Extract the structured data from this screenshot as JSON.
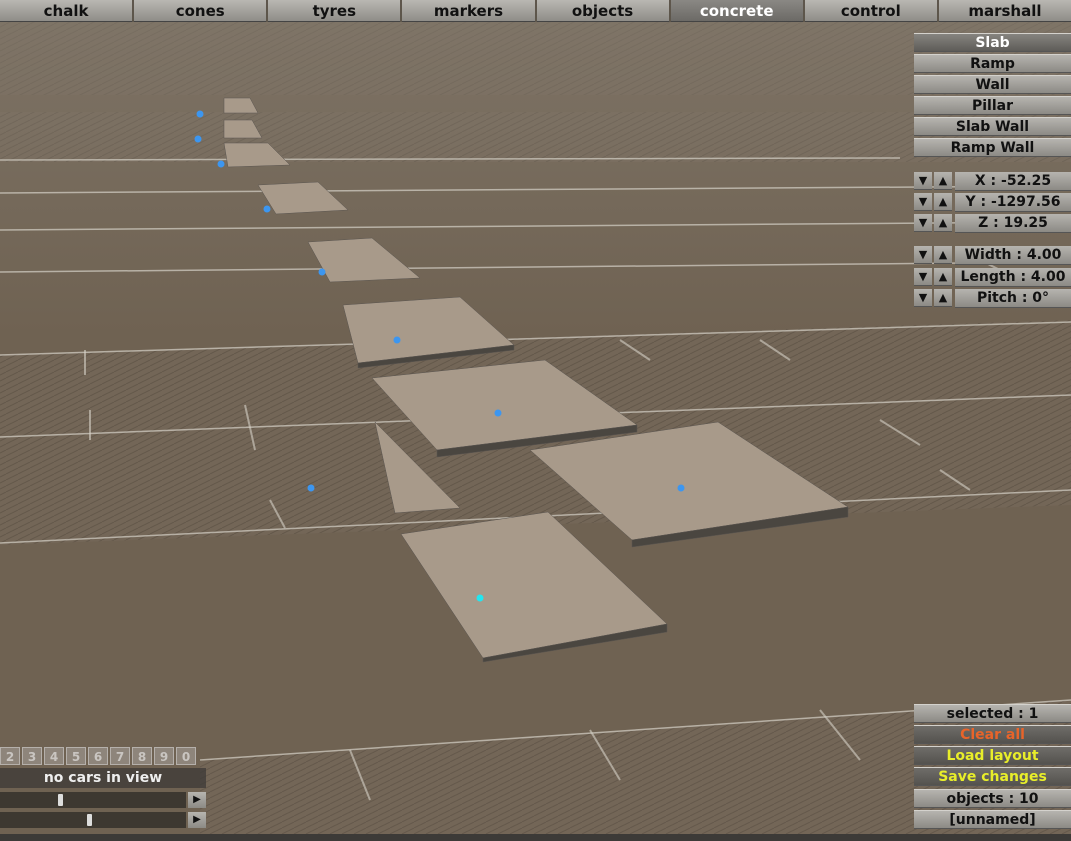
{
  "tabs": [
    {
      "label": "chalk"
    },
    {
      "label": "cones"
    },
    {
      "label": "tyres"
    },
    {
      "label": "markers"
    },
    {
      "label": "objects"
    },
    {
      "label": "concrete",
      "active": true
    },
    {
      "label": "control"
    },
    {
      "label": "marshall"
    }
  ],
  "object_types": [
    {
      "label": "Slab",
      "active": true
    },
    {
      "label": "Ramp"
    },
    {
      "label": "Wall"
    },
    {
      "label": "Pillar"
    },
    {
      "label": "Slab Wall"
    },
    {
      "label": "Ramp Wall"
    }
  ],
  "position": {
    "x": "X : -52.25",
    "y": "Y : -1297.56",
    "z": "Z : 19.25"
  },
  "dimensions": {
    "width": "Width : 4.00",
    "length": "Length : 4.00",
    "pitch": "Pitch : 0°"
  },
  "arrows": {
    "down": "▼",
    "up": "▲",
    "play": "▶"
  },
  "status": {
    "selected": "selected : 1",
    "clear_all": "Clear all",
    "load_layout": "Load layout",
    "save_changes": "Save changes",
    "objects": "objects : 10",
    "layout_name": "[unnamed]"
  },
  "colors": {
    "clear_all": "#e8642a",
    "load_layout": "#e8ee2a",
    "save_changes": "#e8ee2a",
    "marker": "#3c96f0",
    "marker_selected": "#22e6f0"
  },
  "car_numbers": [
    "2",
    "3",
    "4",
    "5",
    "6",
    "7",
    "8",
    "9",
    "0"
  ],
  "cars_view": "no cars in view"
}
